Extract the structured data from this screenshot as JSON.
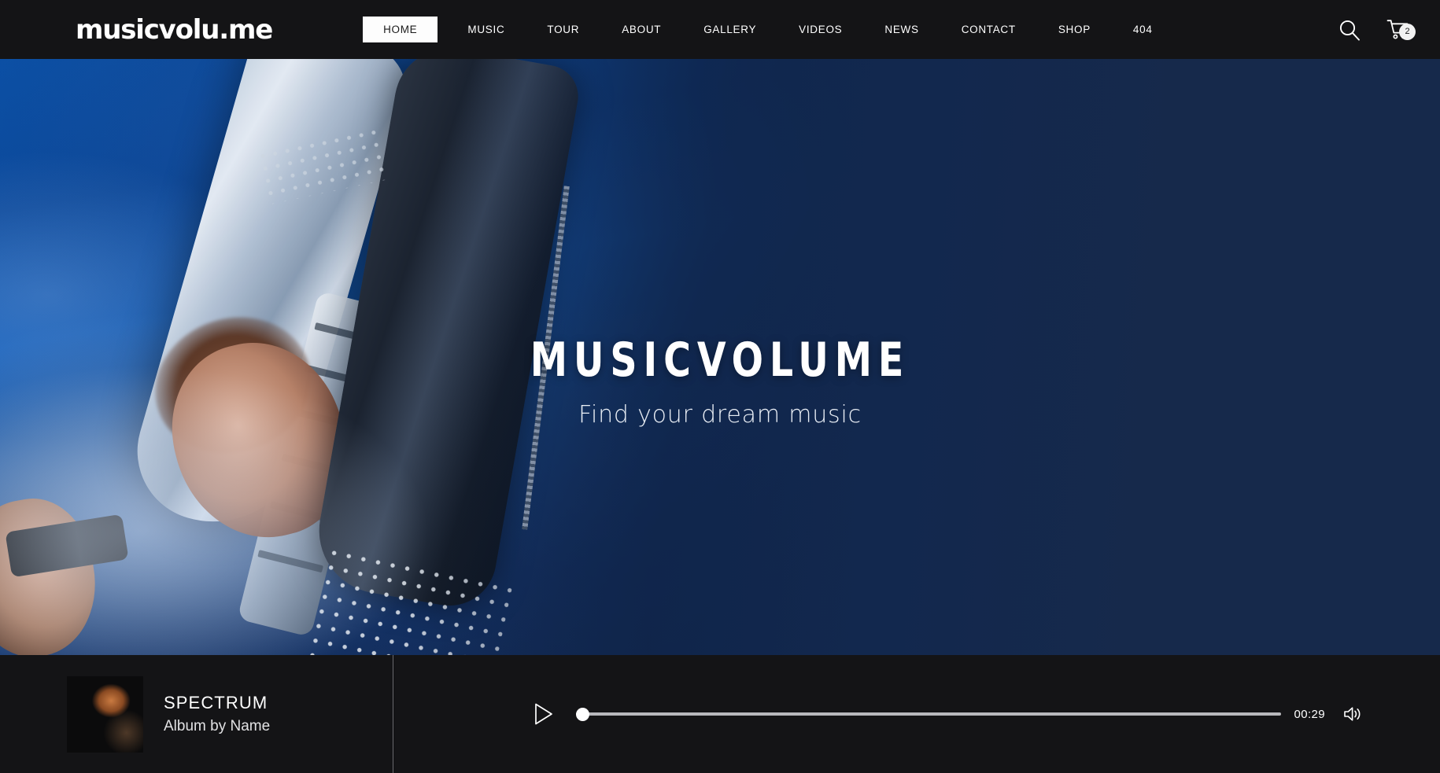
{
  "header": {
    "logo": "musicvolu.me",
    "nav": [
      {
        "label": "HOME",
        "active": true
      },
      {
        "label": "MUSIC",
        "active": false
      },
      {
        "label": "TOUR",
        "active": false
      },
      {
        "label": "ABOUT",
        "active": false
      },
      {
        "label": "GALLERY",
        "active": false
      },
      {
        "label": "VIDEOS",
        "active": false
      },
      {
        "label": "NEWS",
        "active": false
      },
      {
        "label": "CONTACT",
        "active": false
      },
      {
        "label": "SHOP",
        "active": false
      },
      {
        "label": "404",
        "active": false
      }
    ],
    "search_icon": "search-icon",
    "cart_icon": "shopping-cart-icon",
    "cart_count": "2"
  },
  "hero": {
    "title": "MUSICVOLUME",
    "subtitle": "Find your dream music"
  },
  "player": {
    "album_art": "album-artwork",
    "track_title": "SPECTRUM",
    "track_album": "Album by Name",
    "play_icon": "play-icon",
    "progress_percent": 0,
    "time": "00:29",
    "volume_icon": "volume-icon"
  },
  "colors": {
    "header_bg": "#141416",
    "nav_active_bg": "#fdfdfd",
    "nav_active_text": "#1a1a1a",
    "hero_navy": "#16294b",
    "hero_blue": "#0b4fa4",
    "player_bg": "#141416",
    "text_white": "#ffffff",
    "progress_track": "#b8b8bc"
  }
}
